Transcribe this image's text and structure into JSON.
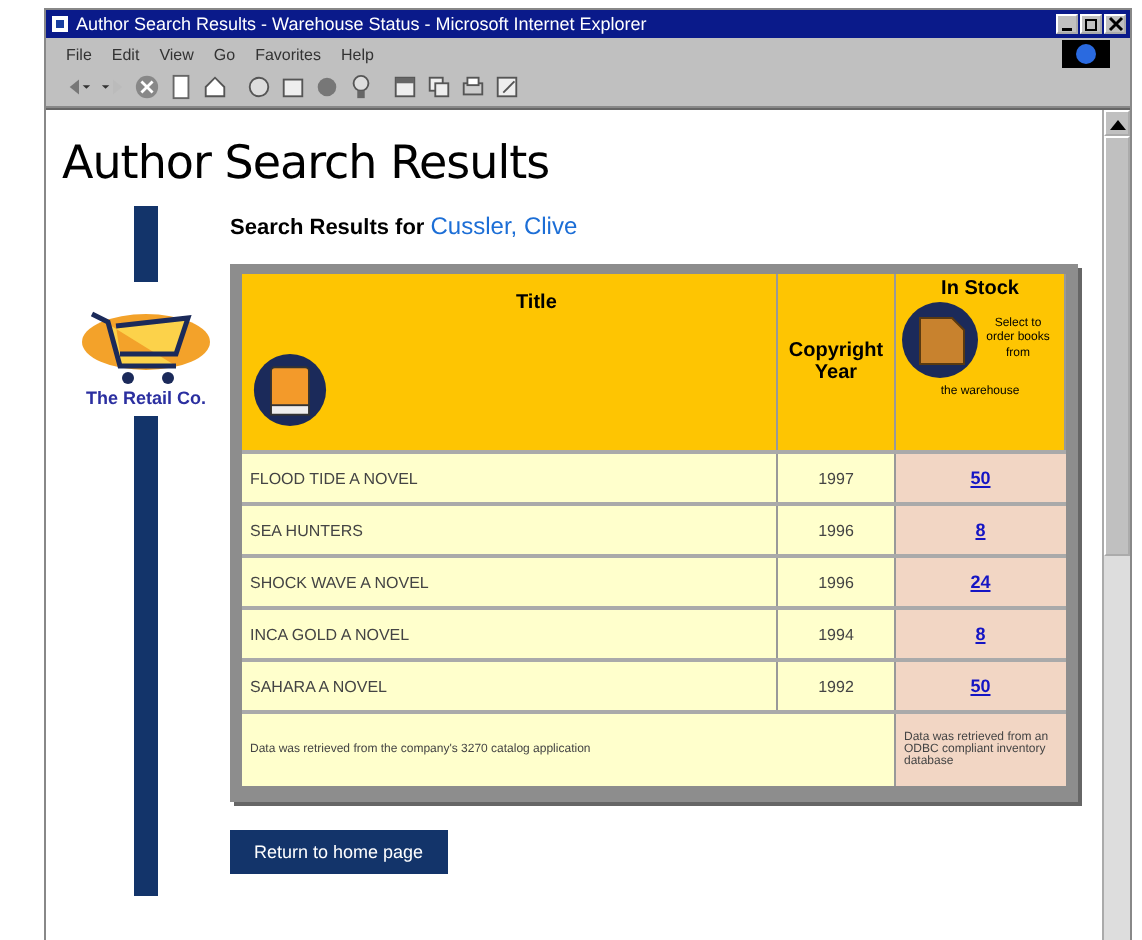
{
  "window": {
    "title": "Author Search Results - Warehouse Status - Microsoft Internet Explorer"
  },
  "menu": [
    "File",
    "Edit",
    "View",
    "Go",
    "Favorites",
    "Help"
  ],
  "page": {
    "heading": "Author Search Results",
    "logo_text": "The Retail Co.",
    "results_label": "Search Results for",
    "author": "Cussler, Clive"
  },
  "table": {
    "columns": [
      {
        "label": "Title"
      },
      {
        "label": "Copyright Year"
      },
      {
        "label": "In Stock"
      }
    ],
    "stock_note": "Select to order books from",
    "stock_note_2": "the warehouse",
    "rows": [
      {
        "title": "FLOOD TIDE A NOVEL",
        "year": "1997",
        "stock": "50"
      },
      {
        "title": "SEA HUNTERS",
        "year": "1996",
        "stock": "8"
      },
      {
        "title": "SHOCK WAVE A NOVEL",
        "year": "1996",
        "stock": "24"
      },
      {
        "title": "INCA GOLD A NOVEL",
        "year": "1994",
        "stock": "8"
      },
      {
        "title": "SAHARA A NOVEL",
        "year": "1992",
        "stock": "50"
      }
    ],
    "footer_left": "Data was retrieved from the company's 3270 catalog application",
    "footer_right": "Data was retrieved from an ODBC compliant inventory database"
  },
  "home_button": "Return to home page"
}
